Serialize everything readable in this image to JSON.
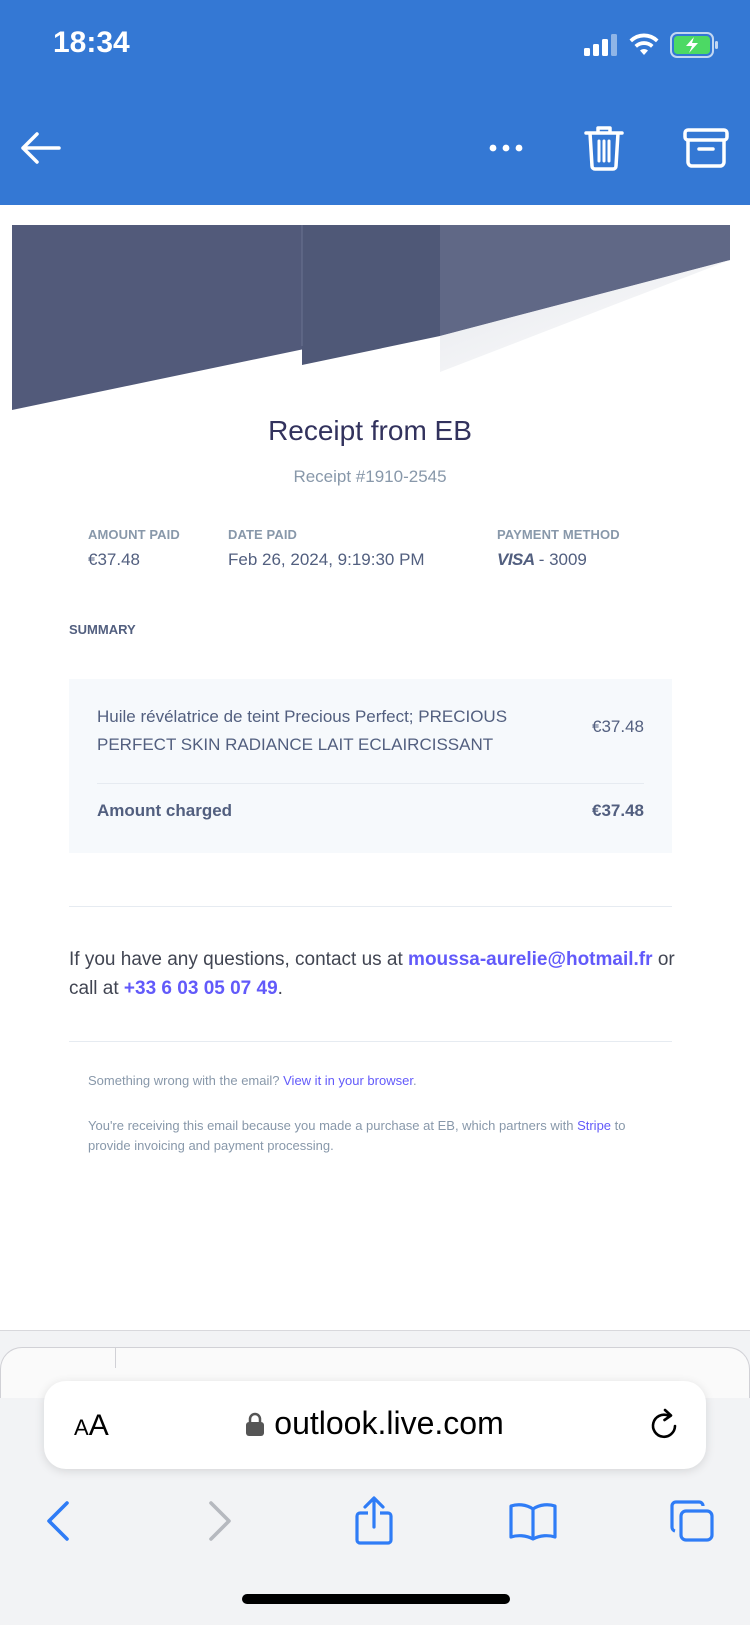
{
  "status_bar": {
    "time": "18:34"
  },
  "header": {
    "icons": [
      "back-arrow-icon",
      "more-icon",
      "trash-icon",
      "archive-icon"
    ],
    "background_color": "#3478d4"
  },
  "receipt": {
    "title": "Receipt from EB",
    "number": "Receipt #1910-2545",
    "amount_paid_label": "AMOUNT PAID",
    "amount_paid": "€37.48",
    "date_paid_label": "DATE PAID",
    "date_paid": "Feb 26, 2024, 9:19:30 PM",
    "payment_method_label": "PAYMENT METHOD",
    "card_brand": "VISA",
    "card_last4": "- 3009",
    "summary_label": "SUMMARY",
    "item_description": "Huile révélatrice de teint Precious Perfect; PRECIOUS PERFECT SKIN RADIANCE LAIT ECLAIRCISSANT",
    "item_price": "€37.48",
    "total_label": "Amount charged",
    "total_value": "€37.48"
  },
  "contact": {
    "prefix": "If you have any questions, contact us at",
    "email": "moussa-aurelie@hotmail.fr",
    "middle": "or call at",
    "phone": "+33 6 03 05 07 49",
    "suffix": "."
  },
  "footer": {
    "wrong_prefix": "Something wrong with the email?",
    "view_link": "View it in your browser",
    "view_suffix": ".",
    "receiving_prefix": "You're receiving this email because you made a purchase at EB, which partners with",
    "stripe_link": "Stripe",
    "receiving_suffix": "to provide invoicing and payment processing."
  },
  "safari": {
    "text_size_label": "AA",
    "url": "outlook.live.com",
    "accent_color": "#2f7cf6"
  }
}
